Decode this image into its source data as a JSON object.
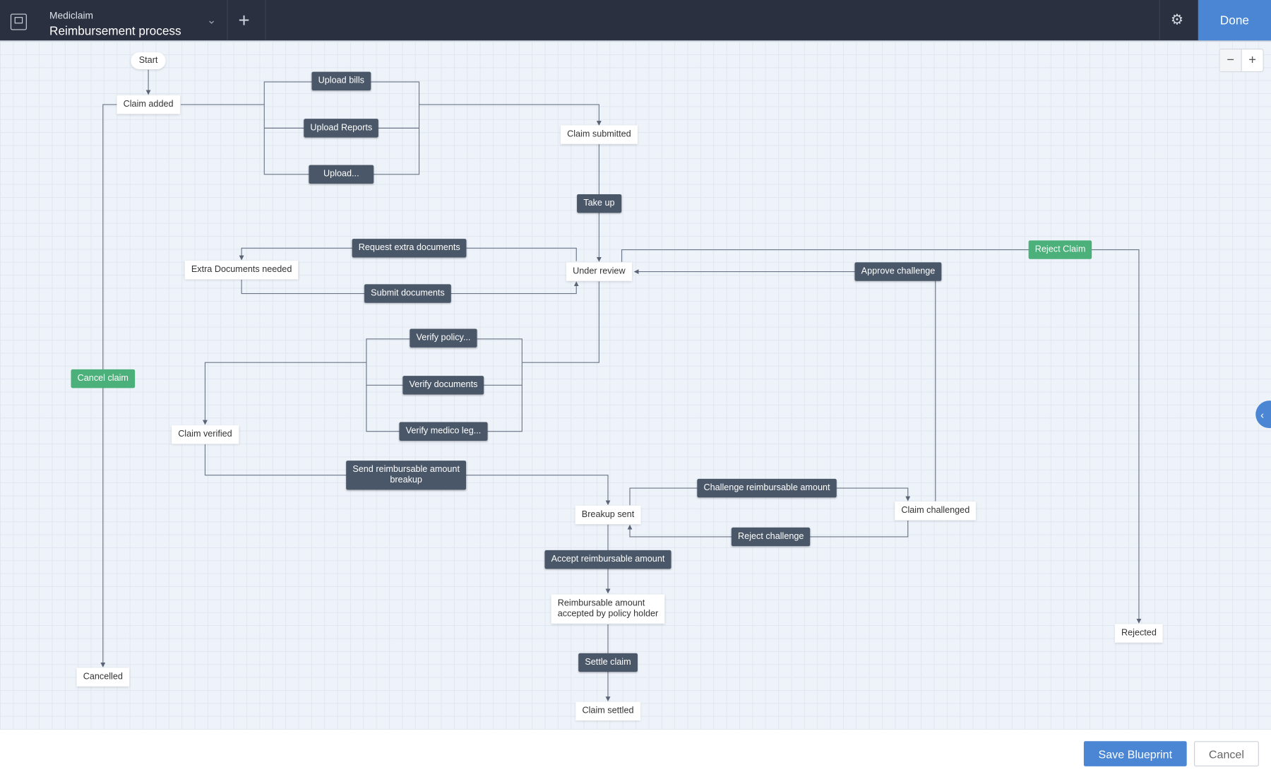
{
  "header": {
    "module": "Mediclaim",
    "title": "Reimbursement process",
    "done_label": "Done",
    "icons": {
      "app": "blueprint-icon",
      "dropdown": "chevron-down-icon",
      "add": "plus-icon",
      "settings": "gear-icon"
    }
  },
  "canvas": {
    "zoom_out": "−",
    "zoom_in": "+",
    "panel_toggle": "‹",
    "states": {
      "start": "Start",
      "claim_added": "Claim added",
      "claim_submitted": "Claim submitted",
      "extra_docs": "Extra Documents needed",
      "under_review": "Under review",
      "claim_verified": "Claim verified",
      "breakup_sent": "Breakup sent",
      "claim_challenged": "Claim challenged",
      "reimb_accepted_1": "Reimbursable amount",
      "reimb_accepted_2": "accepted by policy holder",
      "rejected": "Rejected",
      "cancelled": "Cancelled",
      "claim_settled": "Claim settled"
    },
    "transitions": {
      "upload_bills": "Upload bills",
      "upload_reports": "Upload Reports",
      "upload_more": "Upload...",
      "take_up": "Take up",
      "request_extra": "Request extra documents",
      "submit_docs": "Submit documents",
      "verify_policy": "Verify policy...",
      "verify_docs": "Verify documents",
      "verify_medico": "Verify medico leg...",
      "send_breakup_1": "Send reimbursable amount",
      "send_breakup_2": "breakup",
      "challenge": "Challenge reimbursable amount",
      "reject_challenge": "Reject challenge",
      "accept": "Accept reimbursable amount",
      "settle": "Settle claim",
      "approve_challenge": "Approve challenge",
      "reject_claim": "Reject Claim",
      "cancel_claim": "Cancel claim"
    },
    "colors": {
      "transition": "#4a5768",
      "common_transition": "#4cb07a",
      "accent": "#4a86d4"
    }
  },
  "footer": {
    "save_label": "Save Blueprint",
    "cancel_label": "Cancel"
  }
}
